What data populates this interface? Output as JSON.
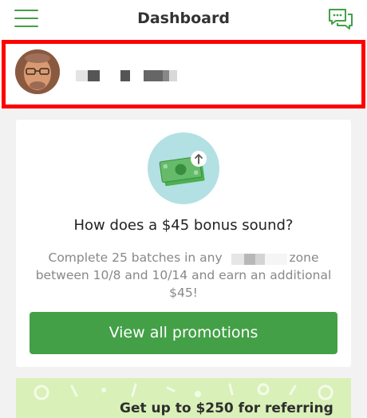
{
  "header": {
    "title": "Dashboard",
    "menu_icon": "hamburger-menu-icon",
    "chat_icon": "chat-bubbles-icon",
    "accent_color": "#43a047"
  },
  "profile": {
    "avatar": "user-avatar-photo",
    "name_redacted": true,
    "highlight_color": "#ff0000"
  },
  "promotion": {
    "icon": "cash-bonus-icon",
    "title": "How does a $45 bonus sound?",
    "description_start": "Complete 25 batches in any",
    "description_end": "zone between 10/8 and 10/14 and earn an additional $45!",
    "zone_redacted": true,
    "button_label": "View all promotions"
  },
  "referral": {
    "text": "Get up to $250 for referring",
    "background_color": "#d9f0b8"
  }
}
